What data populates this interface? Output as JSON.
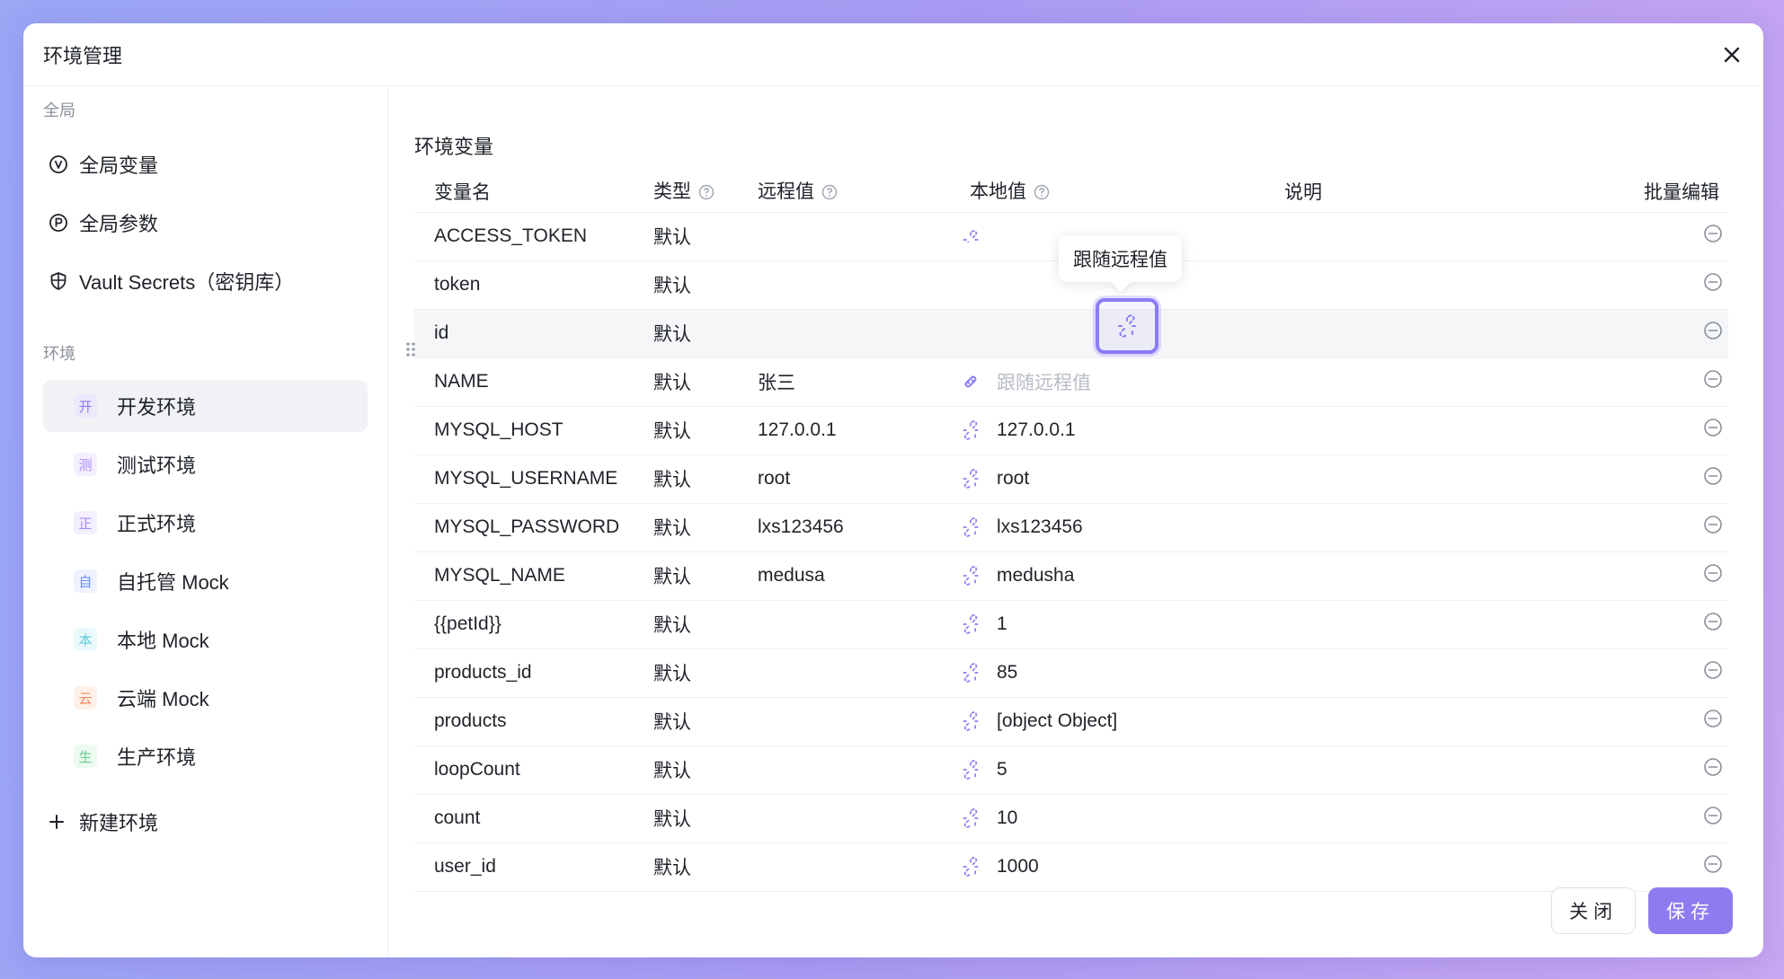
{
  "dialog": {
    "title": "环境管理"
  },
  "sidebar": {
    "global_section": "全局",
    "global_items": [
      {
        "label": "全局变量",
        "icon": "v-circle-icon"
      },
      {
        "label": "全局参数",
        "icon": "p-circle-icon"
      },
      {
        "label": "Vault Secrets（密钥库）",
        "icon": "shield-icon"
      }
    ],
    "env_section": "环境",
    "env_items": [
      {
        "badge": "开",
        "label": "开发环境",
        "color": "#8b7cf6",
        "bg": "#ece9fd",
        "active": true
      },
      {
        "badge": "测",
        "label": "测试环境",
        "color": "#a78bfa",
        "bg": "#f3efff"
      },
      {
        "badge": "正",
        "label": "正式环境",
        "color": "#a78bfa",
        "bg": "#f3efff"
      },
      {
        "badge": "自",
        "label": "自托管 Mock",
        "color": "#6b8cf6",
        "bg": "#eef2ff"
      },
      {
        "badge": "本",
        "label": "本地 Mock",
        "color": "#5bc8d8",
        "bg": "#eafafc"
      },
      {
        "badge": "云",
        "label": "云端 Mock",
        "color": "#f08a5d",
        "bg": "#fff1ea"
      },
      {
        "badge": "生",
        "label": "生产环境",
        "color": "#6dcf8d",
        "bg": "#ecfaf0"
      }
    ],
    "new_env": "新建环境"
  },
  "main": {
    "section_title": "环境变量",
    "columns": {
      "name": "变量名",
      "type": "类型",
      "remote": "远程值",
      "local": "本地值",
      "desc": "说明",
      "bulk": "批量编辑"
    },
    "rows": [
      {
        "name": "ACCESS_TOKEN",
        "type": "默认",
        "remote": "",
        "local": ""
      },
      {
        "name": "token",
        "type": "默认",
        "remote": "",
        "local": ""
      },
      {
        "name": "id",
        "type": "默认",
        "remote": "",
        "local": ""
      },
      {
        "name": "NAME",
        "type": "默认",
        "remote": "张三",
        "local": "",
        "placeholder": "跟随远程值",
        "linked": true
      },
      {
        "name": "MYSQL_HOST",
        "type": "默认",
        "remote": "127.0.0.1",
        "local": "127.0.0.1"
      },
      {
        "name": "MYSQL_USERNAME",
        "type": "默认",
        "remote": "root",
        "local": "root"
      },
      {
        "name": "MYSQL_PASSWORD",
        "type": "默认",
        "remote": "lxs123456",
        "local": "lxs123456"
      },
      {
        "name": "MYSQL_NAME",
        "type": "默认",
        "remote": "medusa",
        "local": "medusha"
      },
      {
        "name": "{{petId}}",
        "type": "默认",
        "remote": "",
        "local": "1"
      },
      {
        "name": "products_id",
        "type": "默认",
        "remote": "",
        "local": "85"
      },
      {
        "name": "products",
        "type": "默认",
        "remote": "",
        "local": "[object Object]"
      },
      {
        "name": "loopCount",
        "type": "默认",
        "remote": "",
        "local": "5"
      },
      {
        "name": "count",
        "type": "默认",
        "remote": "",
        "local": "10"
      },
      {
        "name": "user_id",
        "type": "默认",
        "remote": "",
        "local": "1000"
      }
    ],
    "tooltip": "跟随远程值"
  },
  "footer": {
    "close_label": "关闭",
    "save_label": "保存"
  },
  "colors": {
    "accent": "#8e7bf0",
    "link_icon": "#8b7cf6"
  }
}
